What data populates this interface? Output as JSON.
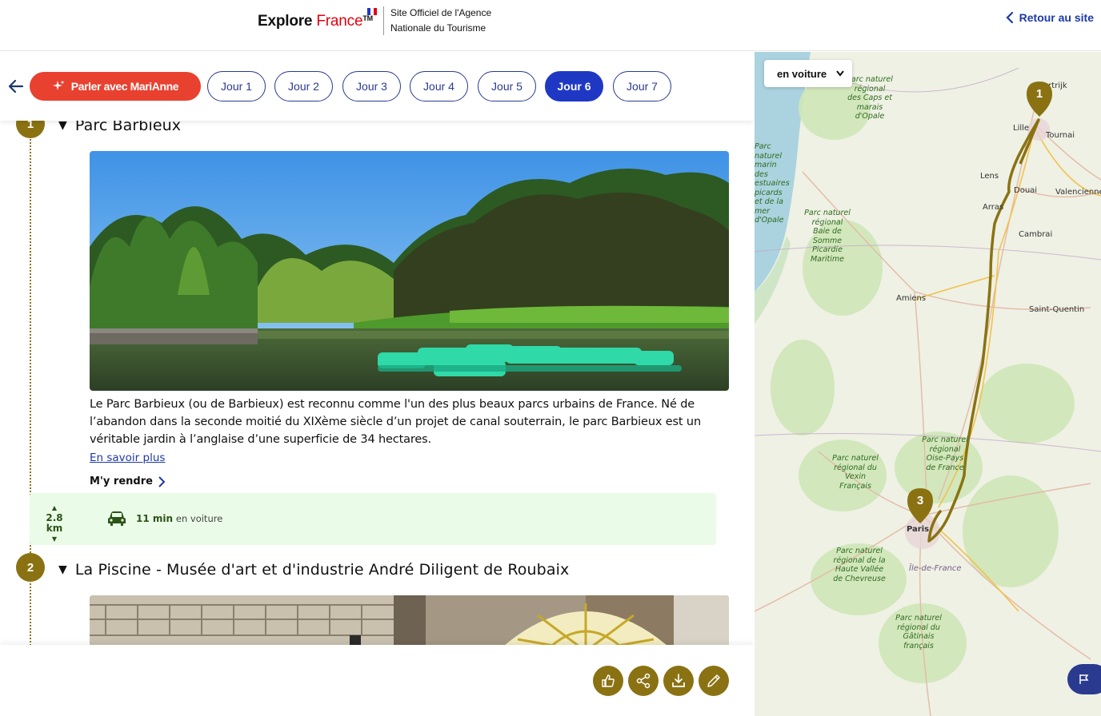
{
  "header": {
    "logo_main": "Explore ",
    "logo_accent": "France",
    "logo_tm": "TM",
    "agency_line1": "Site Officiel de l'Agence",
    "agency_line2": "Nationale du Tourisme",
    "back_label": "Retour au site"
  },
  "tabs": {
    "assistant_label": "Parler avec MariAnne",
    "days": [
      "Jour 1",
      "Jour 2",
      "Jour 3",
      "Jour 4",
      "Jour 5",
      "Jour 6",
      "Jour 7"
    ],
    "active_day": "Jour 6"
  },
  "stops": [
    {
      "number": "1",
      "title": "Parc Barbieux",
      "description": "Le Parc Barbieux (ou de Barbieux) est reconnu comme l'un des plus beaux parcs urbains de France. Né de l’abandon dans la seconde moitié du XIXème siècle d’un projet de canal souterrain, le parc Barbieux est un véritable jardin à l’anglaise d’une superficie de 34 hectares.",
      "more_label": "En savoir plus",
      "go_label": "M'y rendre"
    },
    {
      "number": "2",
      "title": "La Piscine - Musée d'art et d'industrie André Diligent de Roubaix"
    }
  ],
  "travel": {
    "distance": "2.8 km",
    "duration": "11 min",
    "mode_label": "en voiture"
  },
  "actions": [
    "like-icon",
    "share-icon",
    "download-icon",
    "edit-icon"
  ],
  "map": {
    "mode_select": "en voiture",
    "cities": [
      "Lille",
      "Tournai",
      "Kortrijk",
      "Lens",
      "Douai",
      "Valenciennes",
      "Arras",
      "Cambrai",
      "Amiens",
      "Saint-Quentin",
      "Paris",
      "Île-de-France"
    ],
    "parks": [
      "Parc naturel régional des Caps et marais d'Opale",
      "Parc naturel marin des estuaires picards et de la mer d'Opale",
      "Parc naturel régional Baie de Somme Picardie Maritime",
      "Parc naturel régional Oise-Pays de France",
      "Parc naturel régional du Vexin Français",
      "Parc naturel régional de la Haute Vallée de Chevreuse",
      "Parc naturel régional du Gâtinais français"
    ],
    "pins": [
      "1",
      "3"
    ]
  },
  "colors": {
    "accent_red": "#e8412f",
    "day_active": "#1f38c4",
    "gold": "#8a7213",
    "travel_bg": "#eafbe7",
    "navy": "#2a3b8f"
  }
}
